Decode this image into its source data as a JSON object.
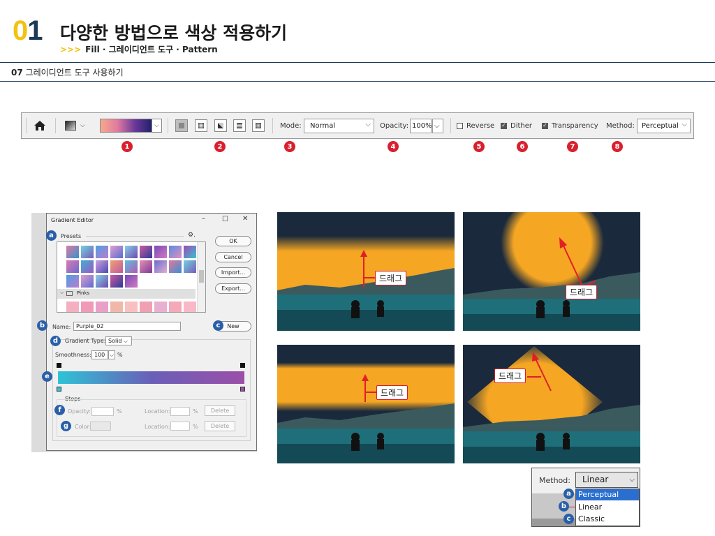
{
  "header": {
    "number_first": "0",
    "number_second": "1",
    "title": "다양한 방법으로 색상 적용하기",
    "sub_arrow": ">>>",
    "subtitle": "Fill · 그레이디언트 도구 · Pattern"
  },
  "section": {
    "num": "07",
    "title": "그레이디언트 도구 사용하기"
  },
  "options_bar": {
    "mode_label": "Mode:",
    "mode_value": "Normal",
    "opacity_label": "Opacity:",
    "opacity_value": "100%",
    "reverse_label": "Reverse",
    "dither_label": "Dither",
    "transparency_label": "Transparency",
    "method_label": "Method:",
    "method_value": "Perceptual",
    "badges": [
      "1",
      "2",
      "3",
      "4",
      "5",
      "6",
      "7",
      "8"
    ],
    "reverse_checked": false,
    "dither_checked": true,
    "transparency_checked": true
  },
  "gradient_editor": {
    "title": "Gradient Editor",
    "presets_label": "Presets",
    "folder_label": "Pinks",
    "ok": "OK",
    "cancel": "Cancel",
    "import": "Import...",
    "export": "Export...",
    "name_label": "Name:",
    "name_value": "Purple_02",
    "new": "New",
    "gradient_type_label": "Gradient Type:",
    "gradient_type_value": "Solid",
    "smoothness_label": "Smoothness:",
    "smoothness_value": "100",
    "percent": "%",
    "stops_label": "Stops",
    "opacity_label": "Opacity:",
    "color_label": "Color:",
    "location_label": "Location:",
    "delete": "Delete",
    "badges": [
      "a",
      "b",
      "c",
      "d",
      "e",
      "f",
      "g"
    ],
    "gradient_colors": [
      "#2ec3d6",
      "#6a5fb8",
      "#9b4fa8"
    ]
  },
  "photos": {
    "drag_label": "드래그",
    "glow_color": "#f5a623",
    "sky_color": "#1a2a3c"
  },
  "method_dropdown": {
    "label": "Method:",
    "value": "Linear",
    "options": [
      "Perceptual",
      "Linear",
      "Classic"
    ],
    "badges": [
      "a",
      "b",
      "c"
    ],
    "selected_bg": "#2a6fd0"
  }
}
